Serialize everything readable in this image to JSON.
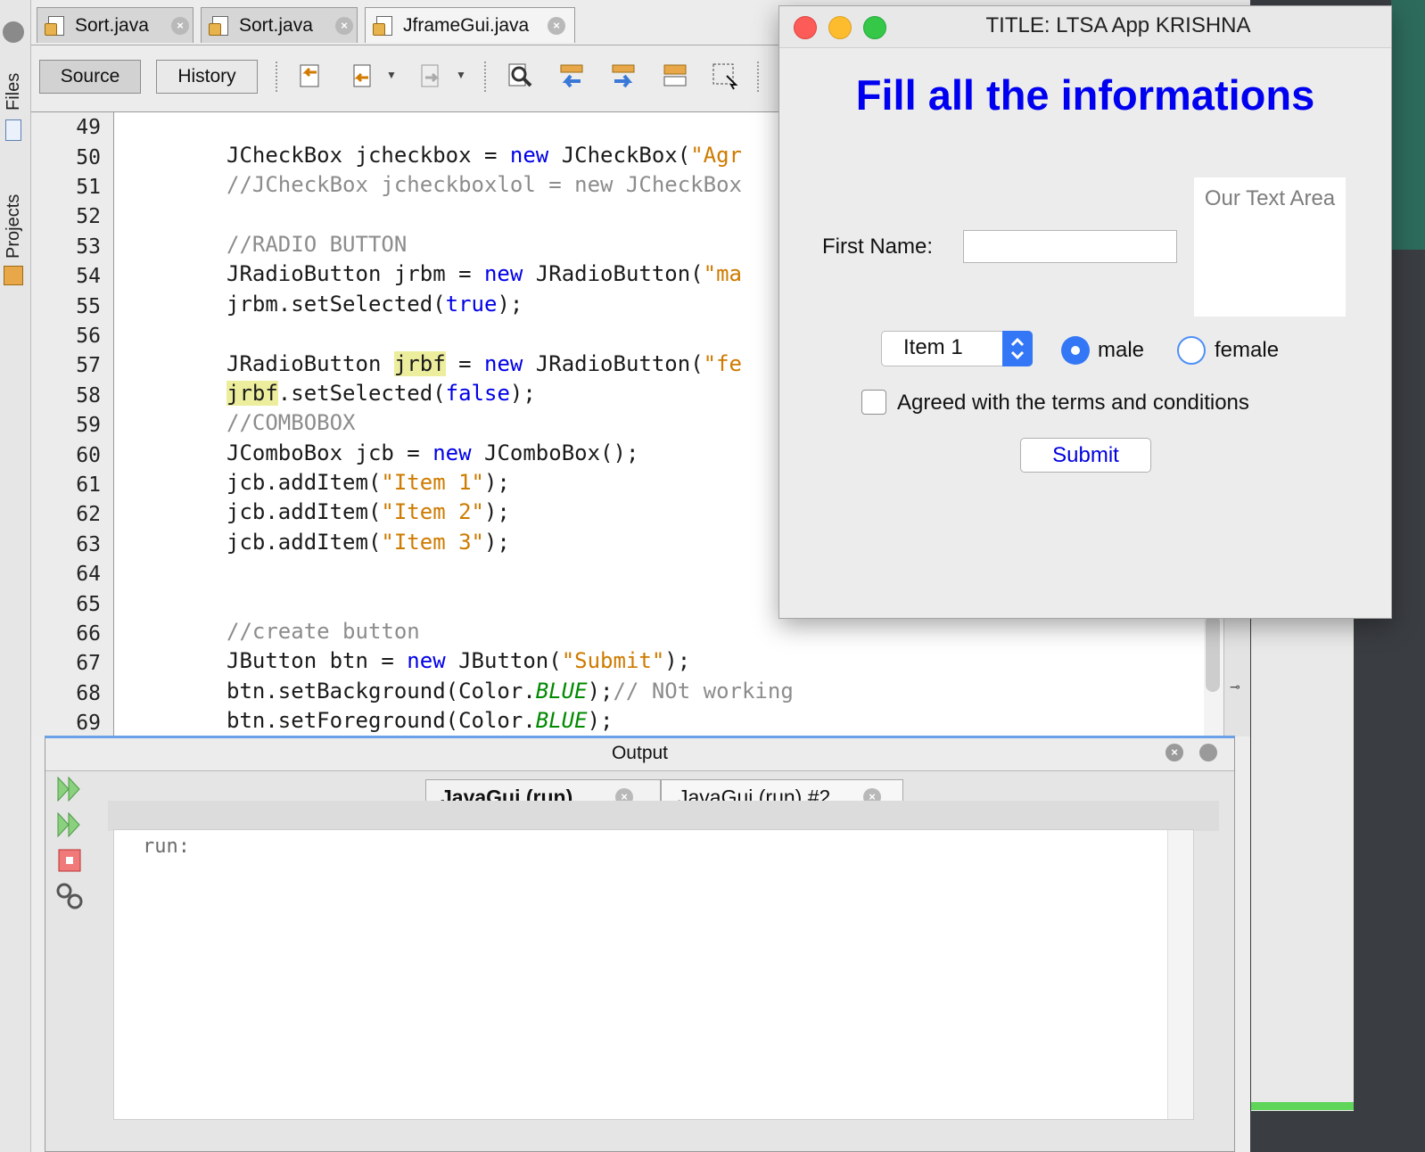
{
  "left_strip": {
    "files": "Files",
    "projects": "Projects"
  },
  "tabs": [
    {
      "label": "Sort.java"
    },
    {
      "label": "Sort.java"
    },
    {
      "label": "JframeGui.java"
    }
  ],
  "toolbar": {
    "source": "Source",
    "history": "History"
  },
  "editor": {
    "line_numbers": [
      "49",
      "50",
      "51",
      "52",
      "53",
      "54",
      "55",
      "56",
      "57",
      "58",
      "59",
      "60",
      "61",
      "62",
      "63",
      "64",
      "65",
      "66",
      "67",
      "68",
      "69"
    ],
    "lines": {
      "l50": {
        "a": "JCheckBox jcheckbox = ",
        "b": "new",
        "c": " JCheckBox(",
        "d": "\"Agr"
      },
      "l51": "//JCheckBox jcheckboxlol = new JCheckBox",
      "l53": "//RADIO BUTTON",
      "l54": {
        "a": "JRadioButton jrbm = ",
        "b": "new",
        "c": " JRadioButton(",
        "d": "\"ma"
      },
      "l55": {
        "a": "jrbm.setSelected(",
        "b": "true",
        "c": ");"
      },
      "l57": {
        "a": "JRadioButton ",
        "h": "jrbf",
        "b": " = ",
        "c": "new",
        "d": " JRadioButton(",
        "e": "\"fe"
      },
      "l58": {
        "h": "jrbf",
        "a": ".setSelected(",
        "b": "false",
        "c": ");"
      },
      "l59": "//COMBOBOX",
      "l60": {
        "a": "JComboBox jcb = ",
        "b": "new",
        "c": " JComboBox();"
      },
      "l61": {
        "a": "jcb.addItem(",
        "b": "\"Item 1\"",
        "c": ");"
      },
      "l62": {
        "a": "jcb.addItem(",
        "b": "\"Item 2\"",
        "c": ");"
      },
      "l63": {
        "a": "jcb.addItem(",
        "b": "\"Item 3\"",
        "c": ");"
      },
      "l66": "//create button",
      "l67": {
        "a": "JButton btn = ",
        "b": "new",
        "c": " JButton(",
        "d": "\"Submit\"",
        "e": ");"
      },
      "l68": {
        "a": "btn.setBackground(Color.",
        "b": "BLUE",
        "c": ");",
        "d": "// NOt working"
      },
      "l69": {
        "a": "btn.setForeground(Color.",
        "b": "BLUE",
        "c": ");"
      }
    }
  },
  "output": {
    "title": "Output",
    "tabs": [
      {
        "label": "JavaGui (run)"
      },
      {
        "label": "JavaGui (run) #2"
      }
    ],
    "content": "run:"
  },
  "dialog": {
    "title": "TITLE: LTSA App KRISHNA",
    "heading": "Fill all the informations",
    "textarea_text": "Our Text Area",
    "first_name_label": "First Name:",
    "first_name_value": "",
    "combo_value": "Item 1",
    "radio_male": "male",
    "radio_female": "female",
    "radio_selected": "male",
    "checkbox_label": "Agreed with the terms and conditions",
    "checkbox_checked": false,
    "submit_label": "Submit"
  },
  "colors": {
    "keyword": "#0000e6",
    "string": "#ce7b00",
    "comment": "#8c8c8c",
    "heading": "#0000f0",
    "accent": "#3477f6",
    "highlight": "#eded9e"
  }
}
